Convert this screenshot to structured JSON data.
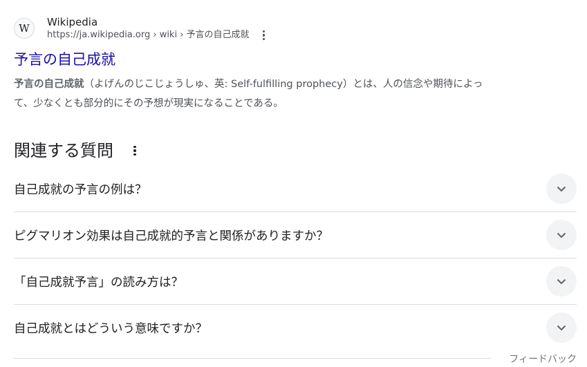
{
  "result": {
    "favicon_letter": "W",
    "site_name": "Wikipedia",
    "url": "https://ja.wikipedia.org › wiki › 予言の自己成就",
    "title": "予言の自己成就",
    "snippet_bold": "予言の自己成就",
    "snippet_line1_rest": "（よげんのじこじょうしゅ、英: Self-fulfilling prophecy）とは、人の信念や期待によっ",
    "snippet_line2": "て、少なくとも部分的にその予想が現実になることである。"
  },
  "related": {
    "heading": "関連する質問",
    "questions": [
      "自己成就の予言の例は？",
      "ピグマリオン効果は自己成就的予言と関係がありますか？",
      "「自己成就予言」の読み方は？",
      "自己成就とはどういう意味ですか？"
    ]
  },
  "feedback": {
    "label": "フィードバック"
  },
  "colors": {
    "link": "#1a0dab",
    "text": "#202124",
    "muted": "#4d5156",
    "divider": "#dadce0",
    "chevron_bg": "#f1f3f4"
  },
  "icons": {
    "favicon": "wikipedia-w",
    "more": "three-dots-vertical",
    "expand": "chevron-down"
  }
}
